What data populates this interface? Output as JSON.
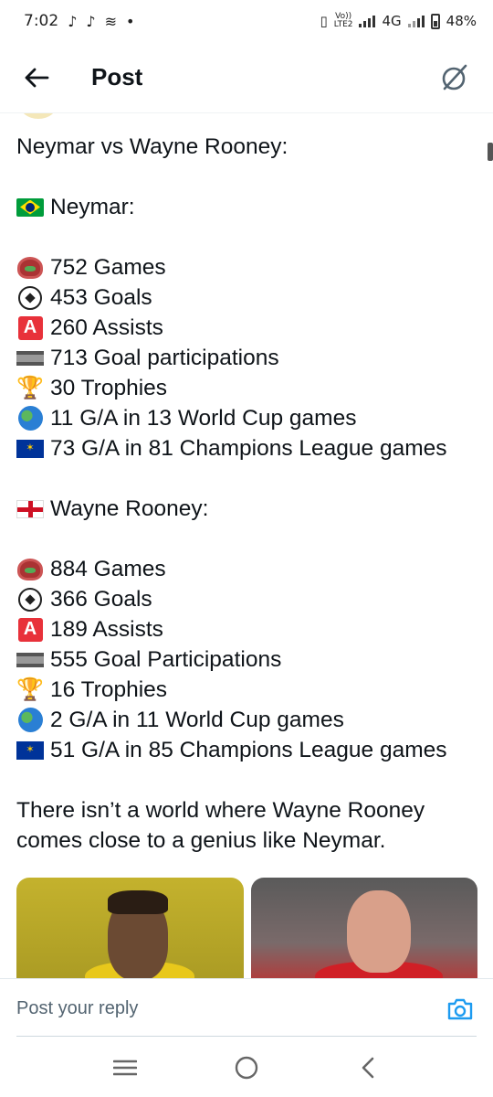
{
  "status_bar": {
    "time": "7:02",
    "notification_icons": [
      "tiktok-icon",
      "tiktok-icon",
      "media-icon"
    ],
    "dot": "•",
    "volte_top": "Vo))",
    "volte_bottom": "LTE2",
    "network": "4G",
    "battery": "48%"
  },
  "header": {
    "title": "Post",
    "back_icon": "arrow-left-icon",
    "grok_icon": "grok-icon"
  },
  "post": {
    "heading": "Neymar vs Wayne Rooney:",
    "player1": {
      "flag": "brazil-flag-icon",
      "name": "Neymar:",
      "stats": [
        {
          "icon": "stadium-icon",
          "text": "752 Games"
        },
        {
          "icon": "soccer-ball-icon",
          "text": "453 Goals"
        },
        {
          "icon": "a-button-icon",
          "text": "260 Assists"
        },
        {
          "icon": "bars-icon",
          "text": "713 Goal participations"
        },
        {
          "icon": "trophy-icon",
          "text": "30 Trophies"
        },
        {
          "icon": "globe-icon",
          "text": "11 G/A in 13 World Cup games"
        },
        {
          "icon": "eu-flag-icon",
          "text": "73 G/A in 81 Champions League games"
        }
      ]
    },
    "player2": {
      "flag": "england-flag-icon",
      "name": "Wayne Rooney:",
      "stats": [
        {
          "icon": "stadium-icon",
          "text": "884 Games"
        },
        {
          "icon": "soccer-ball-icon",
          "text": "366 Goals"
        },
        {
          "icon": "a-button-icon",
          "text": "189 Assists"
        },
        {
          "icon": "bars-icon",
          "text": "555 Goal Participations"
        },
        {
          "icon": "trophy-icon",
          "text": "16 Trophies"
        },
        {
          "icon": "globe-icon",
          "text": "2 G/A in 11 World Cup games"
        },
        {
          "icon": "eu-flag-icon",
          "text": "51 G/A in 85 Champions League games"
        }
      ]
    },
    "closing_line1": "There isn’t a world where Wayne Rooney",
    "closing_line2": "comes close to a genius like Neymar."
  },
  "reply": {
    "placeholder": "Post your reply",
    "camera_icon": "camera-icon"
  },
  "nav": {
    "recents_icon": "recents-icon",
    "home_icon": "home-circle-icon",
    "back_icon": "nav-back-icon"
  }
}
